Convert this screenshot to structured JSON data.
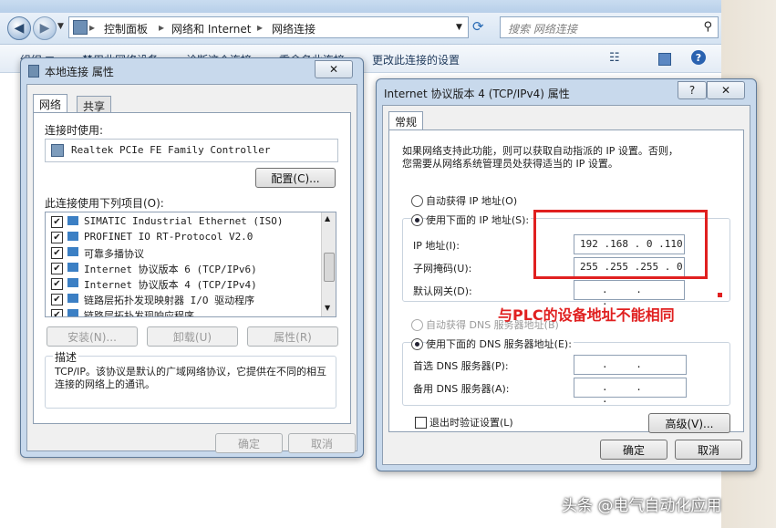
{
  "explorer": {
    "title_fragment": "网络连接",
    "breadcrumbs": [
      "控制面板",
      "网络和 Internet",
      "网络连接"
    ],
    "search_placeholder": "搜索 网络连接",
    "commands": [
      "组织 ▼",
      "禁用此网络设备",
      "诊断这个连接",
      "重命名此连接",
      "更改此连接的设置"
    ]
  },
  "props_dialog": {
    "title": "本地连接 属性",
    "close_label": "✕",
    "tabs": [
      "网络",
      "共享"
    ],
    "connect_using_label": "连接时使用:",
    "adapter": "Realtek PCIe FE Family Controller",
    "configure_button": "配置(C)...",
    "items_label": "此连接使用下列项目(O):",
    "items": [
      {
        "label": "SIMATIC Industrial Ethernet (ISO)",
        "checked": true
      },
      {
        "label": "PROFINET IO RT-Protocol V2.0",
        "checked": true
      },
      {
        "label": "可靠多播协议",
        "checked": true
      },
      {
        "label": "Internet 协议版本 6 (TCP/IPv6)",
        "checked": true
      },
      {
        "label": "Internet 协议版本 4 (TCP/IPv4)",
        "checked": true
      },
      {
        "label": "链路层拓扑发现映射器 I/O 驱动程序",
        "checked": true
      },
      {
        "label": "链路层拓扑发现响应程序",
        "checked": true
      }
    ],
    "install_button": "安装(N)...",
    "uninstall_button": "卸载(U)",
    "properties_button": "属性(R)",
    "description_label": "描述",
    "description_text": "TCP/IP。该协议是默认的广域网络协议，它提供在不同的相互连接的网络上的通讯。",
    "ok_button": "确定",
    "cancel_button": "取消"
  },
  "ipv4_dialog": {
    "title": "Internet 协议版本 4 (TCP/IPv4) 属性",
    "help_label": "?",
    "close_label": "✕",
    "tab": "常规",
    "intro_line1": "如果网络支持此功能，则可以获取自动指派的 IP 设置。否则，",
    "intro_line2": "您需要从网络系统管理员处获得适当的 IP 设置。",
    "auto_ip_label": "自动获得 IP 地址(O)",
    "manual_ip_label": "使用下面的 IP 地址(S):",
    "ip_address_label": "IP 地址(I):",
    "ip_address_value": "192 .168 . 0 .110",
    "subnet_label": "子网掩码(U):",
    "subnet_value": "255 .255 .255 . 0",
    "gateway_label": "默认网关(D):",
    "gateway_value": ". . .",
    "auto_dns_label": "自动获得 DNS 服务器地址(B)",
    "manual_dns_label": "使用下面的 DNS 服务器地址(E):",
    "preferred_dns_label": "首选 DNS 服务器(P):",
    "preferred_dns_value": ". . .",
    "alternate_dns_label": "备用 DNS 服务器(A):",
    "alternate_dns_value": ". . .",
    "validate_label": "退出时验证设置(L)",
    "advanced_button": "高级(V)...",
    "ok_button": "确定",
    "cancel_button": "取消"
  },
  "annotation": {
    "text": "与PLC的设备地址不能相同",
    "color": "#e02020"
  },
  "watermark": "头条 @电气自动化应用"
}
